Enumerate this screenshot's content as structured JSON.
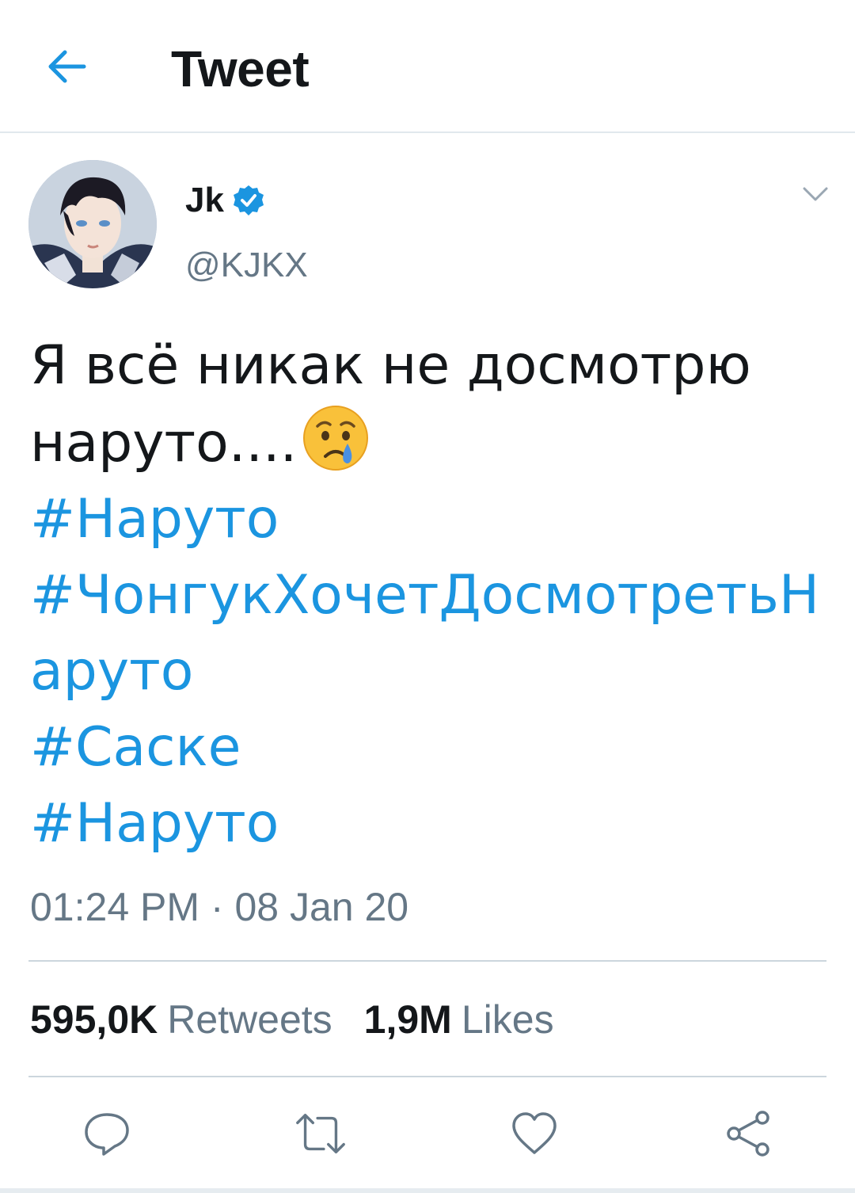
{
  "header": {
    "title": "Tweet",
    "back_icon": "arrow-left-icon"
  },
  "colors": {
    "accent": "#1b95e0",
    "text": "#14171a",
    "secondary": "#657786",
    "divider": "#ccd6dd"
  },
  "author": {
    "display_name": "Jk",
    "handle": "@KJKX",
    "verified": true
  },
  "tweet": {
    "text_lines": [
      "Я всё никак не досмотрю",
      "наруто...."
    ],
    "emoji": "crying-face",
    "hashtags": [
      "#Наруто",
      "#ЧонгукХочетДосмотретьНаруто",
      "#Саске",
      "#Наруто"
    ],
    "timestamp": "01:24 PM · 08 Jan 20"
  },
  "stats": {
    "retweets_count": "595,0K",
    "retweets_label": "Retweets",
    "likes_count": "1,9M",
    "likes_label": "Likes"
  },
  "actions": [
    "reply-icon",
    "retweet-icon",
    "like-icon",
    "share-icon"
  ]
}
